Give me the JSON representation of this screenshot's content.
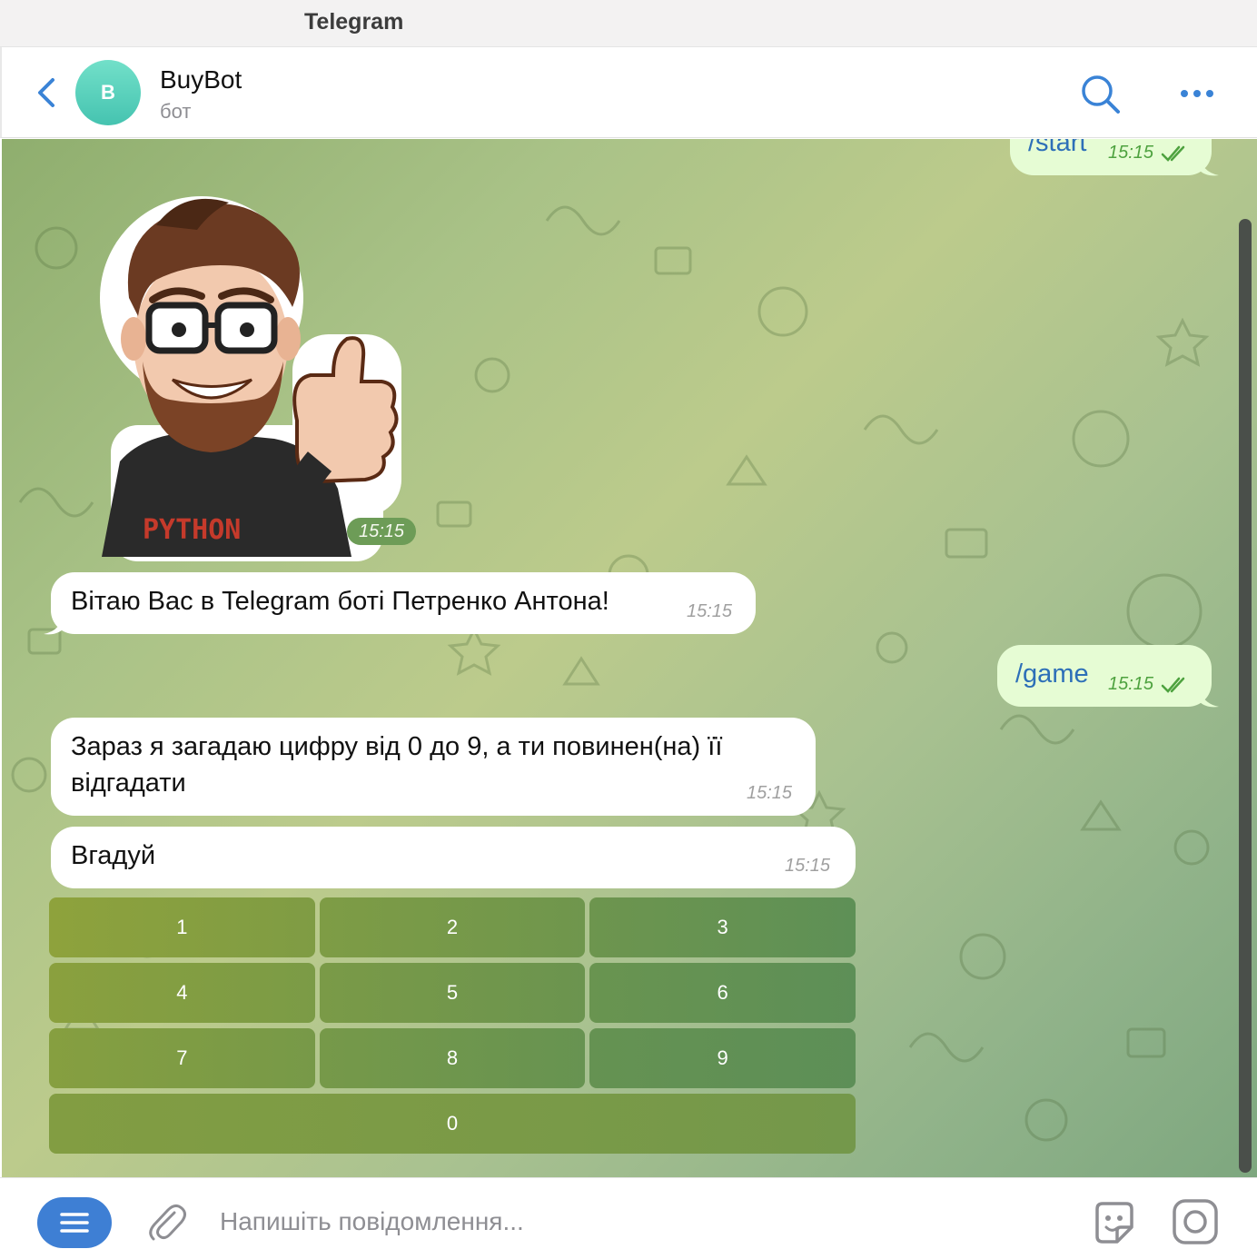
{
  "window": {
    "title": "Telegram"
  },
  "header": {
    "avatar_initial": "B",
    "chat_name": "BuyBot",
    "chat_status": "бот",
    "icons": [
      "chevron-left-icon",
      "search-icon",
      "more-horizontal-icon"
    ]
  },
  "messages": [
    {
      "side": "out",
      "text": "/start",
      "time": "15:15",
      "read": true
    },
    {
      "side": "in",
      "kind": "sticker",
      "sticker": "bearded-man-thumbs-up",
      "sticker_caption": "PYTHON",
      "time": "15:15"
    },
    {
      "side": "in",
      "text": "Вітаю Вас в Telegram боті Петренко Антона!",
      "time": "15:15"
    },
    {
      "side": "out",
      "text": "/game",
      "time": "15:15",
      "read": true
    },
    {
      "side": "in",
      "text": "Зараз я загадаю цифру від 0 до 9, а ти повинен(на) її\nвідгадати",
      "time": "15:15"
    },
    {
      "side": "in",
      "text": "Вгадуй",
      "time": "15:15"
    }
  ],
  "inline_keyboard": [
    [
      "1",
      "2",
      "3"
    ],
    [
      "4",
      "5",
      "6"
    ],
    [
      "7",
      "8",
      "9"
    ],
    [
      "0"
    ]
  ],
  "composer": {
    "placeholder": "Напишіть повідомлення...",
    "icons": [
      "menu-icon",
      "paperclip-icon",
      "sticker-icon",
      "record-icon"
    ]
  },
  "colors": {
    "accent": "#3e7fd4",
    "outgoing_bubble": "#e6fcd4",
    "incoming_bubble": "#ffffff",
    "outgoing_text": "#2d6fb8",
    "read_check": "#4ea23f",
    "keyboard_button_from": "#8ea23c",
    "keyboard_button_to": "#5d8f57"
  }
}
